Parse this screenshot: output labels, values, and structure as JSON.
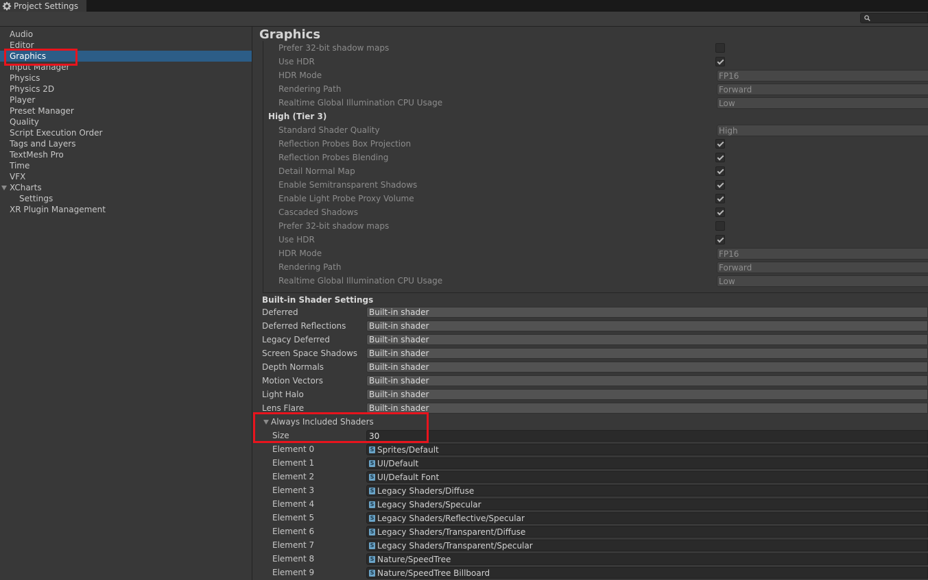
{
  "window": {
    "title": "Project Settings",
    "title_icon": "gear-icon"
  },
  "search": {
    "icon": "search-icon",
    "placeholder": ""
  },
  "sidebar": {
    "items": [
      {
        "label": "Audio"
      },
      {
        "label": "Editor"
      },
      {
        "label": "Graphics",
        "selected": true
      },
      {
        "label": "Input Manager"
      },
      {
        "label": "Physics"
      },
      {
        "label": "Physics 2D"
      },
      {
        "label": "Player"
      },
      {
        "label": "Preset Manager"
      },
      {
        "label": "Quality"
      },
      {
        "label": "Script Execution Order"
      },
      {
        "label": "Tags and Layers"
      },
      {
        "label": "TextMesh Pro"
      },
      {
        "label": "Time"
      },
      {
        "label": "VFX"
      },
      {
        "label": "XCharts",
        "expanded": true
      },
      {
        "label": "Settings",
        "child": true
      },
      {
        "label": "XR Plugin Management"
      }
    ]
  },
  "main": {
    "title": "Graphics",
    "tier2_tail": [
      {
        "label": "Prefer 32-bit shadow maps",
        "kind": "check",
        "checked": false
      },
      {
        "label": "Use HDR",
        "kind": "check",
        "checked": true
      },
      {
        "label": "HDR Mode",
        "kind": "dropdown",
        "value": "FP16"
      },
      {
        "label": "Rendering Path",
        "kind": "dropdown",
        "value": "Forward"
      },
      {
        "label": "Realtime Global Illumination CPU Usage",
        "kind": "dropdown",
        "value": "Low"
      }
    ],
    "tier3": {
      "header": "High (Tier 3)",
      "rows": [
        {
          "label": "Standard Shader Quality",
          "kind": "dropdown",
          "value": "High"
        },
        {
          "label": "Reflection Probes Box Projection",
          "kind": "check",
          "checked": true
        },
        {
          "label": "Reflection Probes Blending",
          "kind": "check",
          "checked": true
        },
        {
          "label": "Detail Normal Map",
          "kind": "check",
          "checked": true
        },
        {
          "label": "Enable Semitransparent Shadows",
          "kind": "check",
          "checked": true
        },
        {
          "label": "Enable Light Probe Proxy Volume",
          "kind": "check",
          "checked": true
        },
        {
          "label": "Cascaded Shadows",
          "kind": "check",
          "checked": true
        },
        {
          "label": "Prefer 32-bit shadow maps",
          "kind": "check",
          "checked": false
        },
        {
          "label": "Use HDR",
          "kind": "check",
          "checked": true
        },
        {
          "label": "HDR Mode",
          "kind": "dropdown",
          "value": "FP16"
        },
        {
          "label": "Rendering Path",
          "kind": "dropdown",
          "value": "Forward"
        },
        {
          "label": "Realtime Global Illumination CPU Usage",
          "kind": "dropdown",
          "value": "Low"
        }
      ]
    },
    "builtin": {
      "header": "Built-in Shader Settings",
      "rows": [
        {
          "label": "Deferred",
          "value": "Built-in shader"
        },
        {
          "label": "Deferred Reflections",
          "value": "Built-in shader"
        },
        {
          "label": "Legacy Deferred",
          "value": "Built-in shader"
        },
        {
          "label": "Screen Space Shadows",
          "value": "Built-in shader"
        },
        {
          "label": "Depth Normals",
          "value": "Built-in shader"
        },
        {
          "label": "Motion Vectors",
          "value": "Built-in shader"
        },
        {
          "label": "Light Halo",
          "value": "Built-in shader"
        },
        {
          "label": "Lens Flare",
          "value": "Built-in shader"
        }
      ]
    },
    "always_included": {
      "header": "Always Included Shaders",
      "size_label": "Size",
      "size_value": "30",
      "elements": [
        {
          "label": "Element 0",
          "value": "Sprites/Default"
        },
        {
          "label": "Element 1",
          "value": "UI/Default"
        },
        {
          "label": "Element 2",
          "value": "UI/Default Font"
        },
        {
          "label": "Element 3",
          "value": "Legacy Shaders/Diffuse"
        },
        {
          "label": "Element 4",
          "value": "Legacy Shaders/Specular"
        },
        {
          "label": "Element 5",
          "value": "Legacy Shaders/Reflective/Specular"
        },
        {
          "label": "Element 6",
          "value": "Legacy Shaders/Transparent/Diffuse"
        },
        {
          "label": "Element 7",
          "value": "Legacy Shaders/Transparent/Specular"
        },
        {
          "label": "Element 8",
          "value": "Nature/SpeedTree"
        },
        {
          "label": "Element 9",
          "value": "Nature/SpeedTree Billboard"
        }
      ]
    }
  },
  "colors": {
    "background": "#383838",
    "selection": "#2c5d87",
    "highlight_box": "#e8141d"
  }
}
